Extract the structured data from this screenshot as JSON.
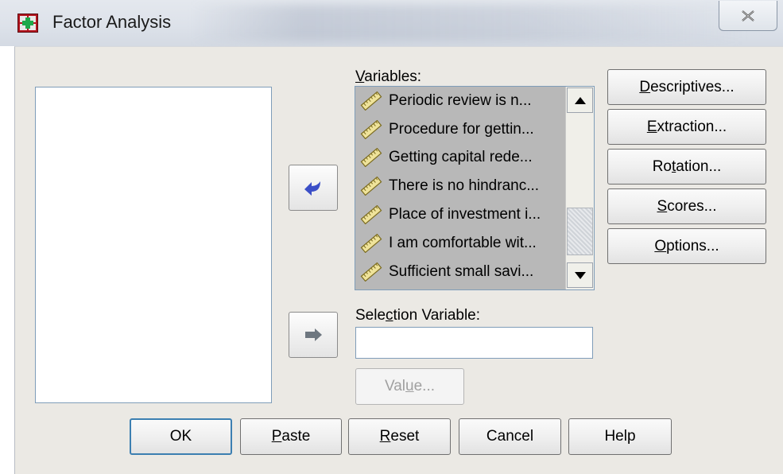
{
  "window": {
    "title": "Factor Analysis"
  },
  "variables": {
    "label_pre": "",
    "label_key": "V",
    "label_post": "ariables:",
    "items": [
      "Periodic review is n...",
      "Procedure for gettin...",
      "Getting capital rede...",
      "There is no hindranc...",
      "Place of investment i...",
      "I am comfortable wit...",
      "Sufficient small savi..."
    ]
  },
  "selection": {
    "label_pre": "Sele",
    "label_key": "c",
    "label_post": "tion Variable:",
    "value": ""
  },
  "side_buttons": [
    {
      "pre": "",
      "key": "D",
      "post": "escriptives..."
    },
    {
      "pre": "",
      "key": "E",
      "post": "xtraction..."
    },
    {
      "pre": "Ro",
      "key": "t",
      "post": "ation..."
    },
    {
      "pre": "",
      "key": "S",
      "post": "cores..."
    },
    {
      "pre": "",
      "key": "O",
      "post": "ptions..."
    }
  ],
  "value_button": {
    "pre": "Val",
    "key": "u",
    "post": "e..."
  },
  "bottom_buttons": [
    {
      "pre": "OK",
      "key": "",
      "post": ""
    },
    {
      "pre": "",
      "key": "P",
      "post": "aste"
    },
    {
      "pre": "",
      "key": "R",
      "post": "eset"
    },
    {
      "pre": "Cancel",
      "key": "",
      "post": ""
    },
    {
      "pre": "Help",
      "key": "",
      "post": ""
    }
  ],
  "colors": {
    "accent_arrow": "#3b4fc7",
    "disabled_arrow": "#6e7780",
    "list_bg": "#b8b8b8"
  }
}
